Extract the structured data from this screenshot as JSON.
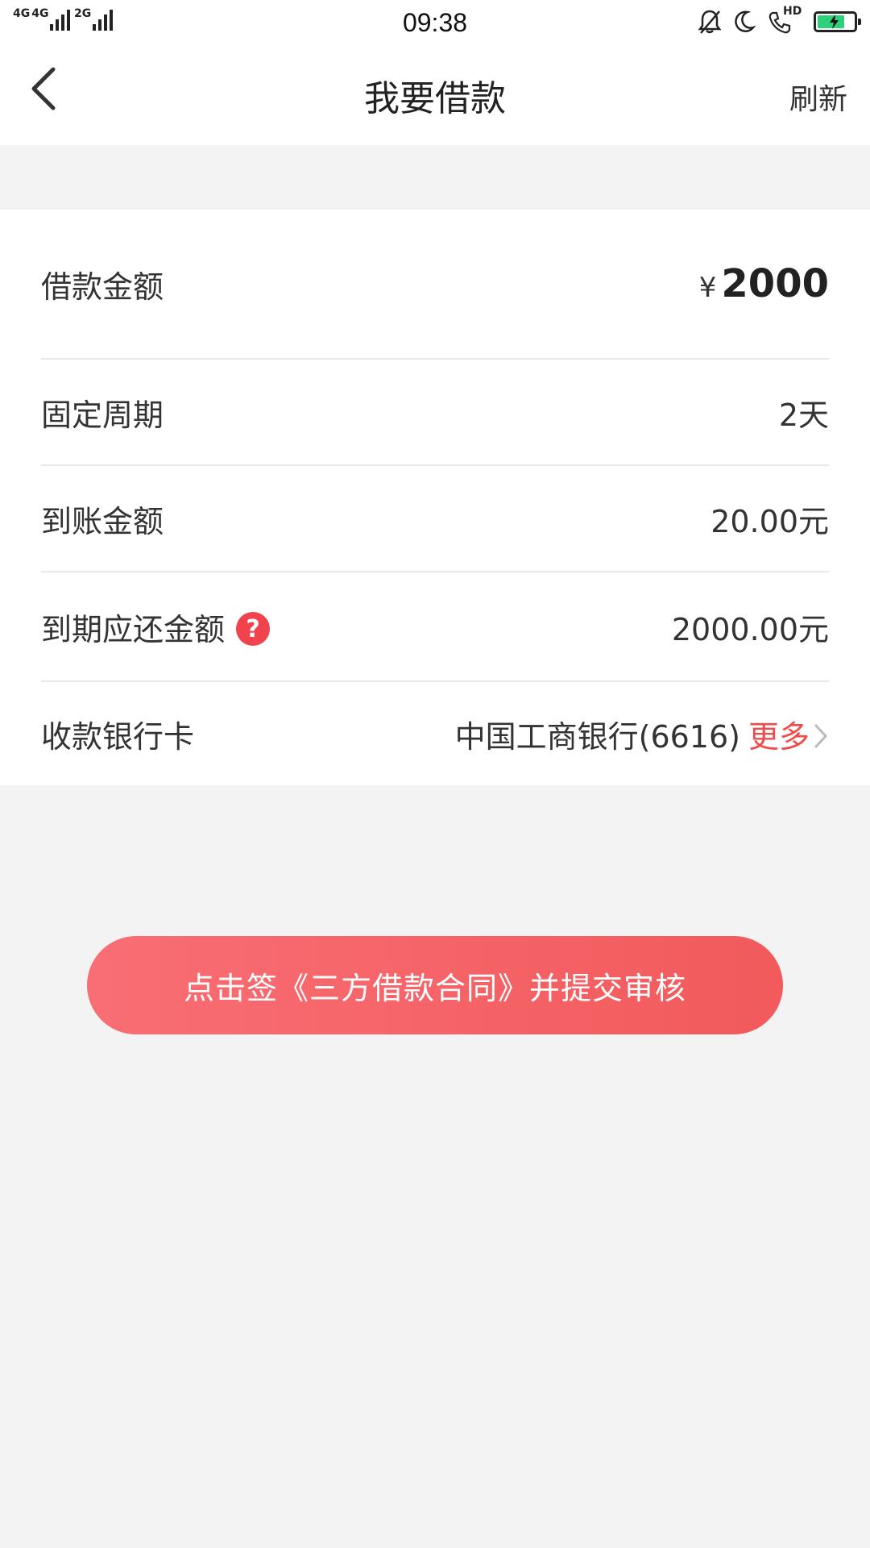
{
  "status_bar": {
    "signal1_label": "4G",
    "signal2_label": "4G",
    "signal3_label": "2G",
    "time": "09:38",
    "hd_label": "HD",
    "battery_level": 0.75,
    "battery_color": "#2fd07a"
  },
  "navbar": {
    "title": "我要借款",
    "refresh_label": "刷新"
  },
  "loan": {
    "amount_label": "借款金额",
    "amount_currency": "¥",
    "amount_value": "2000",
    "period_label": "固定周期",
    "period_value": "2天",
    "received_label": "到账金额",
    "received_value": "20.00元",
    "due_label": "到期应还金额",
    "due_help_symbol": "?",
    "due_value": "2000.00元",
    "bank_label": "收款银行卡",
    "bank_value": "中国工商银行(6616)",
    "bank_more": "更多"
  },
  "actions": {
    "submit_label": "点击签《三方借款合同》并提交审核"
  },
  "colors": {
    "accent_red": "#ef4b4b",
    "button_gradient_start": "#f86e74",
    "button_gradient_end": "#f25a5c",
    "background": "#f3f3f3"
  },
  "icons": [
    "back-arrow-icon",
    "signal-icon",
    "bell-muted-icon",
    "moon-icon",
    "hd-call-icon",
    "battery-charging-icon",
    "help-icon",
    "chevron-right-icon"
  ]
}
